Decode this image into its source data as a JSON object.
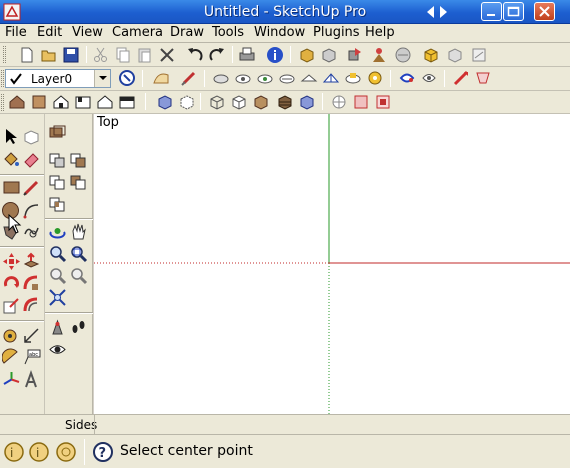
{
  "window": {
    "title": "Untitled - SketchUp Pro"
  },
  "menu": [
    "File",
    "Edit",
    "View",
    "Camera",
    "Draw",
    "Tools",
    "Window",
    "Plugins",
    "Help"
  ],
  "layers": {
    "current": "Layer0"
  },
  "viewport": {
    "view_label": "Top"
  },
  "tray": {
    "label": "Sides"
  },
  "status": {
    "text": "Select center point"
  },
  "colors": {
    "red_axis": "#c0282a",
    "green_axis": "#2a9a2a",
    "viewport_bg": "#ffffff",
    "chrome": "#ece9d8"
  },
  "icons": {
    "standard_toolbar": [
      "new-icon",
      "open-icon",
      "save-icon",
      "cut-icon",
      "copy-icon",
      "paste-icon",
      "erase-icon",
      "undo-icon",
      "redo-icon",
      "print-icon",
      "model-info-icon"
    ],
    "sharing_toolbar": [
      "get-models-icon",
      "share-model-icon",
      "share-component-icon",
      "get-photo-texture-icon",
      "preview-google-earth-icon",
      "3d-warehouse-icon",
      "extension-warehouse-icon",
      "send-to-layout-icon"
    ],
    "view_toolbar": [
      "iso-icon",
      "top-icon",
      "front-icon",
      "right-icon",
      "back-icon",
      "left-icon"
    ],
    "style_toolbar": [
      "xray-icon",
      "back-edges-icon",
      "wireframe-icon",
      "hidden-line-icon",
      "shaded-icon",
      "shaded-textures-icon",
      "monochrome-icon"
    ],
    "section_toolbar": [
      "section-plane-icon",
      "display-section-planes-icon",
      "display-section-cuts-icon"
    ]
  }
}
